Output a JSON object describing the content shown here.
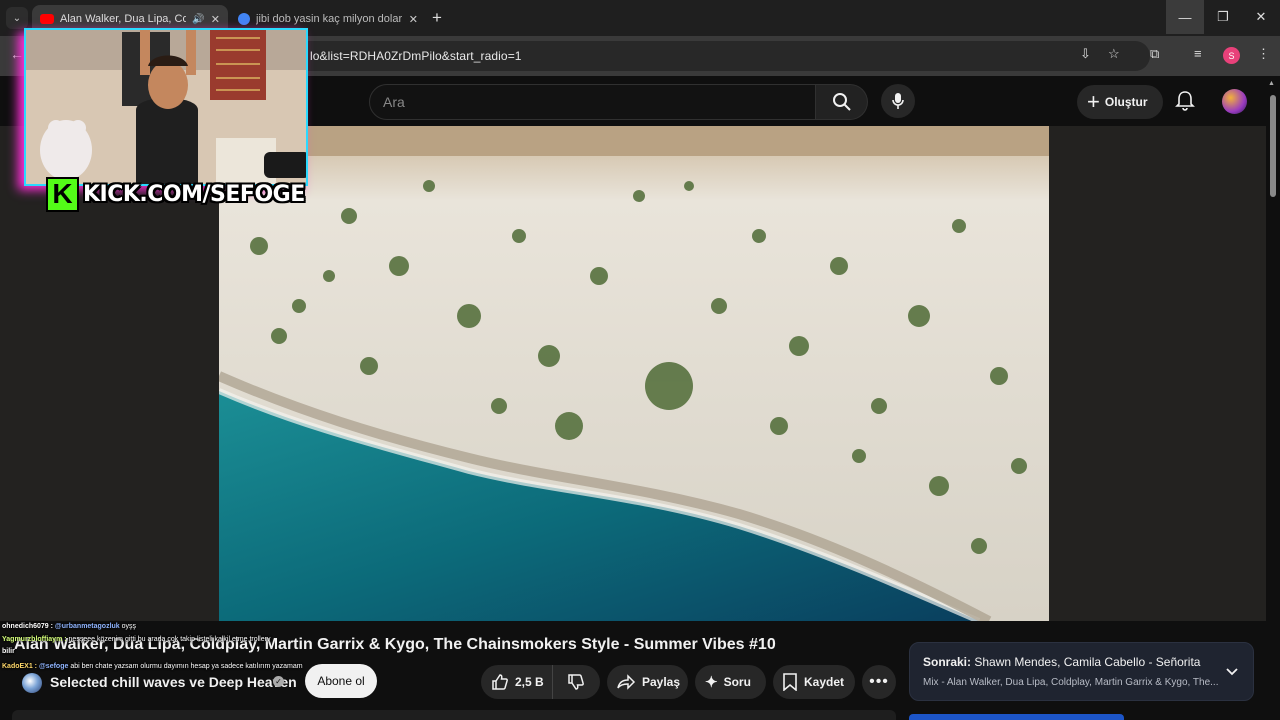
{
  "browser": {
    "tabs": [
      {
        "title": "Alan Walker, Dua Lipa, Cold",
        "favicon_color": "#ff0000"
      },
      {
        "title": "jibi dob yasin kaç milyon dolar",
        "favicon_color": "#4285f4"
      }
    ],
    "url": "lo&list=RDHA0ZrDmPilo&start_radio=1",
    "profile_letter": "S"
  },
  "youtube": {
    "search_placeholder": "Ara",
    "create_label": "Oluştur"
  },
  "overlay": {
    "kick_logo": "K",
    "kick_text": "KICK.COM/SEFOGE"
  },
  "video": {
    "title": "Alan Walker, Dua Lipa, Coldplay, Martin Garrix & Kygo, The Chainsmokers Style - Summer Vibes #10",
    "channel": "Selected chill waves ve Deep Heaven",
    "subscribe_label": "Abone ol",
    "likes": "2,5 B",
    "share_label": "Paylaş",
    "ask_label": "Soru",
    "save_label": "Kaydet"
  },
  "up_next": {
    "prefix": "Sonraki:",
    "title": "Shawn Mendes, Camila Cabello - Señorita",
    "subtitle": "Mix - Alan Walker, Dua Lipa, Coldplay, Martin Garrix & Kygo, The..."
  },
  "chat": [
    {
      "user": "ohnedich6079 :",
      "mention": "@urbanmetagozluk",
      "text": "oyşş"
    },
    {
      "user": "Yagmurzbloffiaym :",
      "mention": "",
      "text": "neşşeee közenim gitti bu arada çok takip listeli kalkil etme trollerv"
    },
    {
      "user": "bilir",
      "mention": "",
      "text": ""
    },
    {
      "user": "KadoEX1 :",
      "mention": "@sefoge",
      "text": "abi ben chate yazsam olurmu dayımın hesap ya sadece katılırım yazamam"
    }
  ],
  "colors": {
    "kick_green": "#53fc18",
    "cam_border": "#2ad9ff",
    "cam_glow": "#ff2fd8",
    "yt_red": "#ff0000",
    "next_card_bg": "#1f2430"
  }
}
